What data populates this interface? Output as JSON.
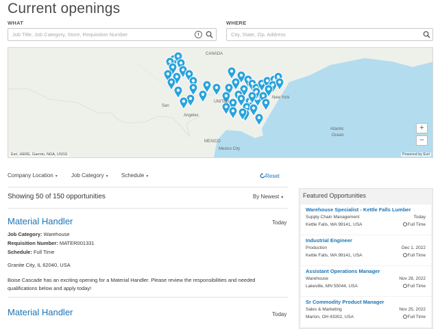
{
  "page": {
    "title": "Current openings"
  },
  "search": {
    "what_label": "WHAT",
    "what_placeholder": "Job Title, Job Category, Store, Requisition Number",
    "where_label": "WHERE",
    "where_placeholder": "City, State, Zip, Address"
  },
  "map": {
    "labels": {
      "canada": "CANADA",
      "united": "UNITED",
      "mexico": "MEXICO",
      "mexico_city": "Mexico City",
      "atlantic": "Atlantic",
      "ocean": "Ocean",
      "new_york": "New York",
      "angeles": "Angeles",
      "san": "San"
    },
    "attribution": "Esri, HERE, Garmin, NGA, USGS",
    "powered_by": "Powered by Esri",
    "zoom_in": "+",
    "zoom_out": "−",
    "pin_color": "#2aa3dc"
  },
  "filters": {
    "company_location": "Company Location",
    "job_category": "Job Category",
    "schedule": "Schedule",
    "reset": "Reset"
  },
  "results": {
    "showing": "Showing 50 of 150 opportunities",
    "sort": "By Newest"
  },
  "jobs": [
    {
      "title": "Material Handler",
      "date": "Today",
      "category_label": "Job Category:",
      "category": "Warehouse",
      "req_label": "Requisition Number:",
      "req": "MATER001331",
      "schedule_label": "Schedule:",
      "schedule": "Full Time",
      "location": "Granite City, IL 62040, USA",
      "description": "Boise Cascade has an exciting opening for a Material Handler. Please review the responsibilities and needed qualifications below and apply today!"
    },
    {
      "title": "Material Handler",
      "date": "Today"
    }
  ],
  "featured": {
    "heading": "Featured Opportunities",
    "items": [
      {
        "title": "Warehouse Specialist - Kettle Falls Lumber",
        "category": "Supply Chain Management",
        "date": "Today",
        "location": "Kettle Falls, WA 99141, USA",
        "type": "Full Time"
      },
      {
        "title": "Industrial Engineer",
        "category": "Production",
        "date": "Dec 1, 2022",
        "location": "Kettle Falls, WA 99141, USA",
        "type": "Full Time"
      },
      {
        "title": "Assistant Operations Manager",
        "category": "Warehouse",
        "date": "Nov 28, 2022",
        "location": "Lakeville, MN 55044, USA",
        "type": "Full Time"
      },
      {
        "title": "Sr Commodity Product Manager",
        "category": "Sales & Marketing",
        "date": "Nov 25, 2022",
        "location": "Marion, OH 43302, USA",
        "type": "Full Time"
      }
    ]
  },
  "colors": {
    "link": "#1a73b6",
    "ocean": "#b3dcef",
    "land": "#eef0ea"
  }
}
